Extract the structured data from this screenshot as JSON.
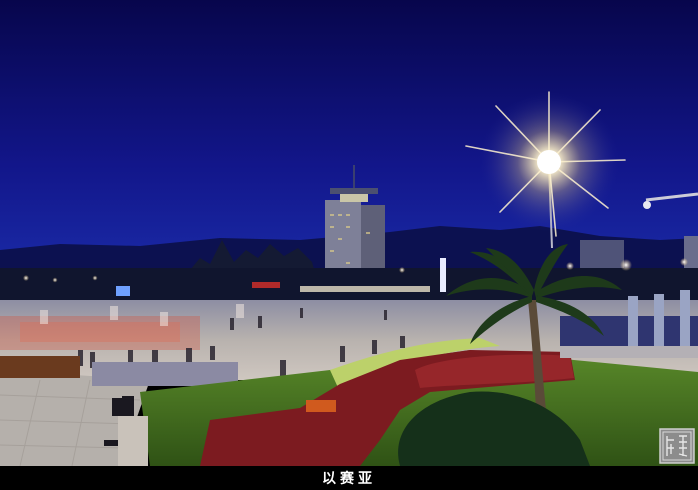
{
  "caption": "以赛亚",
  "seal_text": "陈锦",
  "colors": {
    "sky_top": "#0a0a5e",
    "sky_mid": "#14178a",
    "sky_horizon": "#1b2aa8",
    "lamp_glow": "#fff6d8",
    "lawn": "#3f6a1f",
    "hedge": "#7a1a1e",
    "plaza": "#b9b2ad"
  }
}
